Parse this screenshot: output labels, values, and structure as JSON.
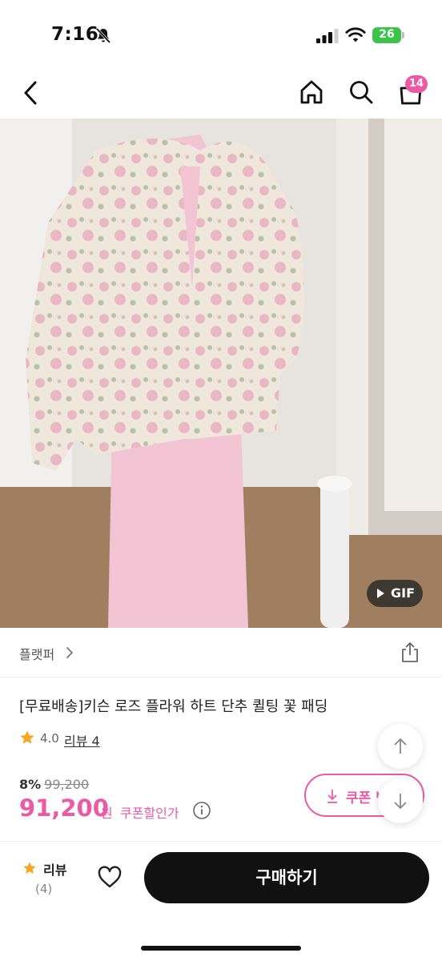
{
  "status_bar": {
    "time": "7:16",
    "battery_level": "26",
    "icons": [
      "bell-muted-icon",
      "signal-icon",
      "wifi-icon",
      "battery-icon"
    ],
    "battery_color": "#3cc44a"
  },
  "header": {
    "icons": [
      "back-arrow-icon",
      "home-icon",
      "search-icon",
      "shopping-bag-icon"
    ],
    "cart_count": "14",
    "badge_color": "#ec5aa6"
  },
  "product_image": {
    "badge_label": "GIF"
  },
  "store": {
    "name": "플랫퍼"
  },
  "product": {
    "title": "[무료배송]키슨 로즈 플라워 하트 단추 퀼팅 꽃 패딩",
    "rating": "4.0",
    "review_link": "리뷰 4",
    "discount_rate": "8%",
    "original_price": "99,200",
    "sale_price": "91,200",
    "currency": "원",
    "coupon_price_label": "쿠폰할인가",
    "coupon_button_label": "쿠폰 받",
    "accent_color": "#ec5aa6"
  },
  "bottom_bar": {
    "review_label": "리뷰",
    "review_count": "(4)",
    "buy_label": "구매하기"
  }
}
